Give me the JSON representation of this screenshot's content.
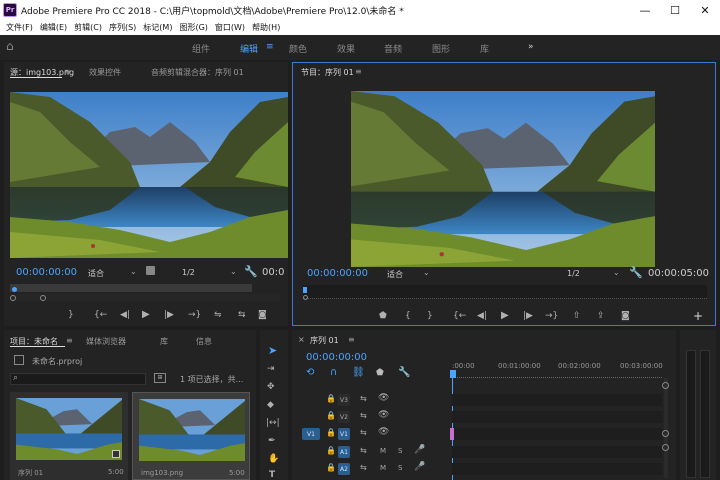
{
  "app": {
    "title": "Adobe Premiere Pro CC 2018 - C:\\用户\\topmold\\文档\\Adobe\\Premiere Pro\\12.0\\未命名 *",
    "logo": "Pr"
  },
  "menu": [
    "文件(F)",
    "编辑(E)",
    "剪辑(C)",
    "序列(S)",
    "标记(M)",
    "图形(G)",
    "窗口(W)",
    "帮助(H)"
  ],
  "workspaces": {
    "items": [
      "组件",
      "编辑",
      "颜色",
      "效果",
      "音频",
      "图形",
      "库"
    ],
    "active": "编辑",
    "more": "»"
  },
  "source_panel": {
    "tabs": [
      "源：img103.png",
      "效果控件",
      "音频剪辑混合器：序列 01"
    ],
    "timecode": "00:00:00:00",
    "fit": "适合",
    "resolution": "1/2",
    "end_timecode": "00:0"
  },
  "program_panel": {
    "tab": "节目：序列 01",
    "timecode": "00:00:00:00",
    "fit": "适合",
    "resolution": "1/2",
    "end_timecode": "00:00:05:00"
  },
  "project_panel": {
    "tabs": [
      "项目：未命名",
      "媒体浏览器",
      "库",
      "信息"
    ],
    "file": "未命名.prproj",
    "selection": "1 项已选择，共...",
    "items": [
      {
        "name": "序列 01",
        "duration": "5:00"
      },
      {
        "name": "img103.png",
        "duration": "5:00"
      }
    ]
  },
  "timeline": {
    "tab": "序列 01",
    "timecode": "00:00:00:00",
    "ruler": [
      ":00:00",
      "00:01:00:00",
      "00:02:00:00",
      "00:03:00:00"
    ],
    "tracks": [
      {
        "target": "",
        "name": "V3"
      },
      {
        "target": "",
        "name": "V2"
      },
      {
        "target": "V1",
        "name": "V1"
      },
      {
        "target": "",
        "name": "A1",
        "m": "M",
        "s": "S"
      },
      {
        "target": "",
        "name": "A2",
        "m": "M",
        "s": "S"
      }
    ]
  },
  "colors": {
    "accent": "#4aa3ff",
    "panel": "#232323",
    "background": "#1e1e1e",
    "clip": "#c56fd0"
  }
}
